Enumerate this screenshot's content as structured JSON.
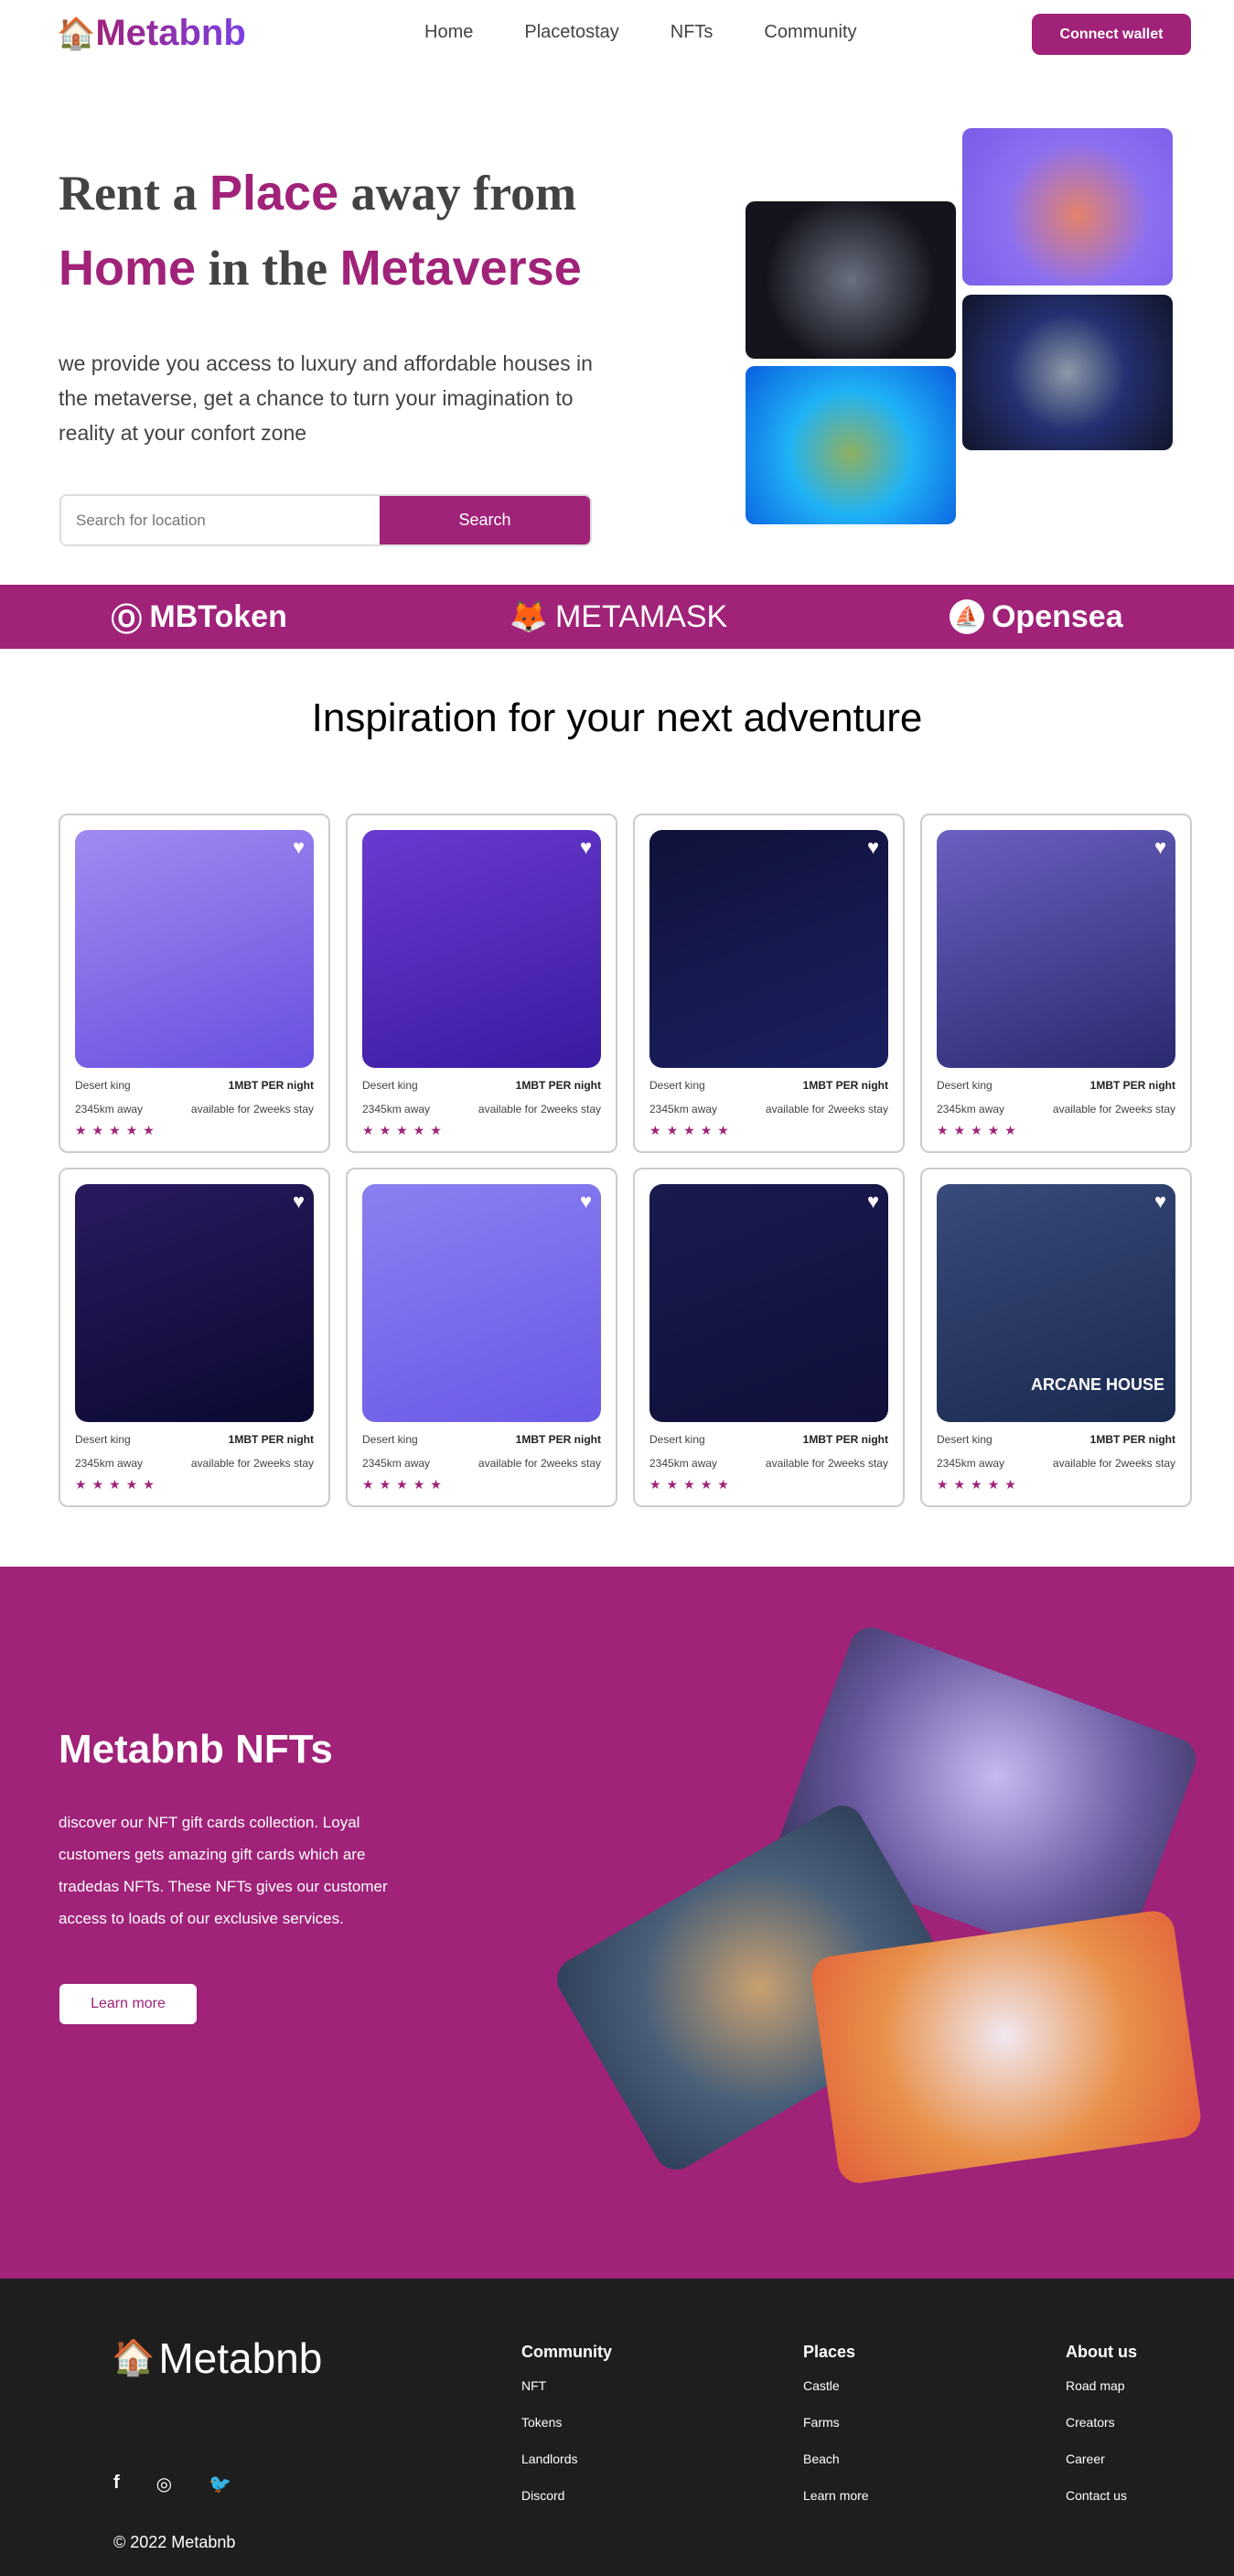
{
  "brand": {
    "name": "Metabnb",
    "accent": "#A02279",
    "footer_bg": "#1E1E1E"
  },
  "nav": {
    "links": [
      "Home",
      "Placetostay",
      "NFTs",
      "Community"
    ],
    "connect_wallet": "Connect wallet"
  },
  "hero": {
    "title_1": "Rent a ",
    "title_2": "Place",
    "title_3": " away from",
    "title_4": "Home",
    "title_5": " in the ",
    "title_6": "Metaverse",
    "description": "we provide you access to luxury and affordable houses in the metaverse, get a chance to turn your imagination to reality at your confort zone",
    "search_placeholder": "Search for location",
    "search_button": "Search"
  },
  "partners": [
    "MBToken",
    "METAMASK",
    "Opensea"
  ],
  "inspiration": {
    "title": "Inspiration for your next adventure",
    "cards": [
      {
        "name": "Desert king",
        "price": "1MBT PER night",
        "distance": "2345km away",
        "availability": "available for 2weeks stay",
        "rating": 5
      },
      {
        "name": "Desert king",
        "price": "1MBT PER night",
        "distance": "2345km away",
        "availability": "available for 2weeks stay",
        "rating": 5
      },
      {
        "name": "Desert king",
        "price": "1MBT PER night",
        "distance": "2345km away",
        "availability": "available for 2weeks stay",
        "rating": 5
      },
      {
        "name": "Desert king",
        "price": "1MBT PER night",
        "distance": "2345km away",
        "availability": "available for 2weeks stay",
        "rating": 5
      },
      {
        "name": "Desert king",
        "price": "1MBT PER night",
        "distance": "2345km away",
        "availability": "available for 2weeks stay",
        "rating": 5
      },
      {
        "name": "Desert king",
        "price": "1MBT PER night",
        "distance": "2345km away",
        "availability": "available for 2weeks stay",
        "rating": 5
      },
      {
        "name": "Desert king",
        "price": "1MBT PER night",
        "distance": "2345km away",
        "availability": "available for 2weeks stay",
        "rating": 5
      },
      {
        "name": "Desert king",
        "price": "1MBT PER night",
        "distance": "2345km away",
        "availability": "available for 2weeks stay",
        "rating": 5,
        "image_text": "ARCANE HOUSE"
      }
    ]
  },
  "nfts": {
    "title": "Metabnb NFTs",
    "description": "discover our NFT gift cards collection. Loyal customers gets amazing gift cards which are tradedas NFTs. These NFTs gives our customer access to loads of our exclusive services.",
    "button": "Learn more"
  },
  "footer": {
    "logo": "Metabnb",
    "columns": [
      {
        "title": "Community",
        "links": [
          "NFT",
          "Tokens",
          "Landlords",
          "Discord"
        ]
      },
      {
        "title": "Places",
        "links": [
          "Castle",
          "Farms",
          "Beach",
          "Learn more"
        ]
      },
      {
        "title": "About us",
        "links": [
          "Road map",
          "Creators",
          "Career",
          "Contact us"
        ]
      }
    ],
    "social": [
      "facebook-icon",
      "instagram-icon",
      "twitter-icon"
    ],
    "copyright": "© 2022 Metabnb"
  }
}
